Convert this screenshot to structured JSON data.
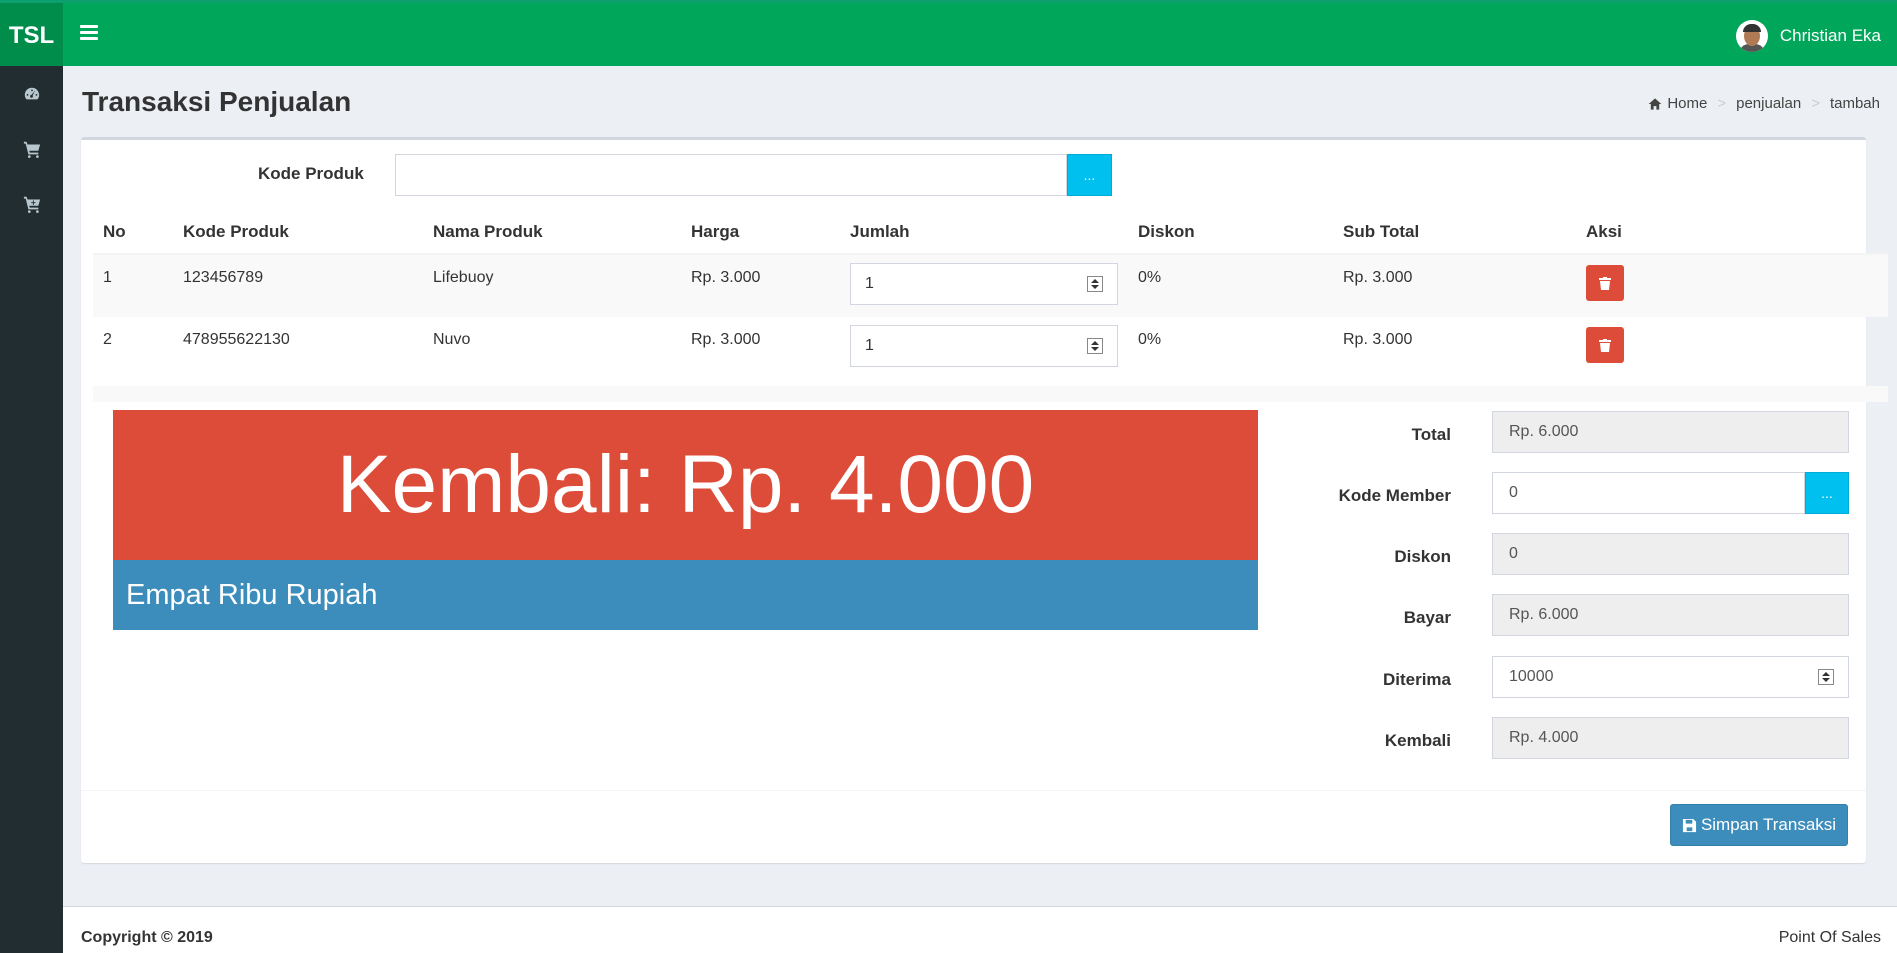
{
  "app": {
    "logo": "TSL",
    "user_name": "Christian Eka"
  },
  "page": {
    "title": "Transaksi Penjualan"
  },
  "breadcrumb": [
    "Home",
    "penjualan",
    "tambah"
  ],
  "search": {
    "label": "Kode Produk",
    "value": "",
    "button_label": "..."
  },
  "table": {
    "headers": [
      "No",
      "Kode Produk",
      "Nama Produk",
      "Harga",
      "Jumlah",
      "Diskon",
      "Sub Total",
      "Aksi"
    ],
    "rows": [
      {
        "no": "1",
        "kode": "123456789",
        "nama": "Lifebuoy",
        "harga": "Rp. 3.000",
        "jumlah": "1",
        "diskon": "0%",
        "subtotal": "Rp. 3.000"
      },
      {
        "no": "2",
        "kode": "478955622130",
        "nama": "Nuvo",
        "harga": "Rp. 3.000",
        "jumlah": "1",
        "diskon": "0%",
        "subtotal": "Rp. 3.000"
      }
    ]
  },
  "display": {
    "kembali": "Kembali: Rp. 4.000",
    "terbilang": "Empat Ribu Rupiah"
  },
  "form": {
    "total": {
      "label": "Total",
      "value": "Rp. 6.000"
    },
    "kode_member": {
      "label": "Kode Member",
      "value": "0",
      "button_label": "..."
    },
    "diskon": {
      "label": "Diskon",
      "value": "0"
    },
    "bayar": {
      "label": "Bayar",
      "value": "Rp. 6.000"
    },
    "diterima": {
      "label": "Diterima",
      "value": "10000"
    },
    "kembali": {
      "label": "Kembali",
      "value": "Rp. 4.000"
    }
  },
  "actions": {
    "save_label": "Simpan Transaksi"
  },
  "footer": {
    "copyright": "Copyright © 2019",
    "app_name": "Point Of Sales"
  },
  "colors": {
    "header": "#00a65a",
    "sidebar": "#222d32",
    "danger": "#dd4b39",
    "primary": "#3c8dbc",
    "info": "#00c0ef"
  },
  "icons": {
    "sidebar": [
      "dashboard-icon",
      "cart-icon",
      "cart-plus-icon"
    ],
    "breadcrumb": "home-icon",
    "delete": "trash-icon",
    "save": "floppy-disk-icon"
  }
}
